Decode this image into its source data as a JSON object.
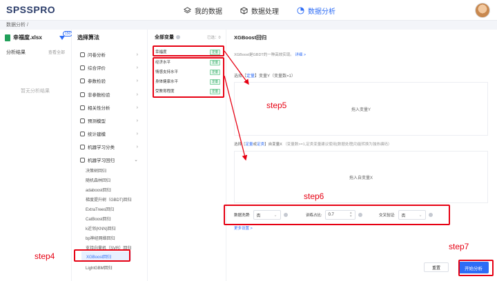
{
  "app": {
    "logo": "SPSSPRO"
  },
  "nav": [
    {
      "label": "我的数据",
      "icon": "layers-icon",
      "active": false
    },
    {
      "label": "数据处理",
      "icon": "cube-icon",
      "active": false
    },
    {
      "label": "数据分析",
      "icon": "pie-chart-icon",
      "active": true
    }
  ],
  "breadcrumb": "数据分析 /",
  "files": {
    "filename": "幸福度.xlsx",
    "badge": "150",
    "results_label": "分析结果",
    "view_all": "查看全部",
    "empty": "暂无分析结果"
  },
  "algorithms": {
    "title": "选择算法",
    "categories": [
      {
        "label": "问卷分析"
      },
      {
        "label": "综合评价"
      },
      {
        "label": "参数检验"
      },
      {
        "label": "非参数检验"
      },
      {
        "label": "相关性分析"
      },
      {
        "label": "预测模型"
      },
      {
        "label": "统计建模"
      },
      {
        "label": "机器学习分类"
      },
      {
        "label": "机器学习回归"
      }
    ],
    "sub_items": [
      {
        "label": "决策树回归"
      },
      {
        "label": "随机森林回归"
      },
      {
        "label": "adaboost回归"
      },
      {
        "label": "梯度提升树（GBDT)回归"
      },
      {
        "label": "ExtraTrees回归"
      },
      {
        "label": "CatBoost回归"
      },
      {
        "label": "k近邻(KNN)回归"
      },
      {
        "label": "bp神经网络回归"
      },
      {
        "label": "支持向量机（SVR）回归"
      },
      {
        "label": "XGBoost回归"
      },
      {
        "label": "LightGBM回归"
      }
    ]
  },
  "variables": {
    "title": "全部变量",
    "selected": "已选：0",
    "items": [
      {
        "label": "幸福度",
        "tag": "定量"
      },
      {
        "label": "经济水平",
        "tag": "定量"
      },
      {
        "label": "情感支持水平",
        "tag": "定量"
      },
      {
        "label": "身体健康水平",
        "tag": "定量"
      },
      {
        "label": "受教育程度",
        "tag": "定量"
      }
    ]
  },
  "config": {
    "title": "XGBoost回归",
    "desc": "XGBoost是GBDT的一种高效实现。",
    "desc_link": "详细 >",
    "y_hint_prefix": "选择",
    "y_hint_hl": "定量",
    "y_hint_suffix": "】变量Y（变量数=1）",
    "y_drop": "拖入变量Y",
    "x_hint_prefix": "选择",
    "x_hint_hl1": "定量",
    "x_hint_mid": "或",
    "x_hint_hl2": "定类",
    "x_hint_suffix": "】自变量X",
    "x_hint_tip": "（变量数>=1,定类变量建议使用[数据处理]功能转换为独热编码）",
    "x_drop": "拖入自变量X",
    "params": {
      "shuffle_label": "数据洗牌:",
      "shuffle_value": "否",
      "ratio_label": "训练占比:",
      "ratio_value": "0.7",
      "cv_label": "交叉验证:",
      "cv_value": "否"
    },
    "more": "更多设置 >",
    "reset": "重置",
    "start": "开始分析"
  },
  "annotations": {
    "step4": "step4",
    "step5": "step5",
    "step6": "step6",
    "step7": "step7"
  },
  "colors": {
    "accent": "#2d6cf6",
    "annotation": "#e60012",
    "tag": "#22a05a"
  }
}
